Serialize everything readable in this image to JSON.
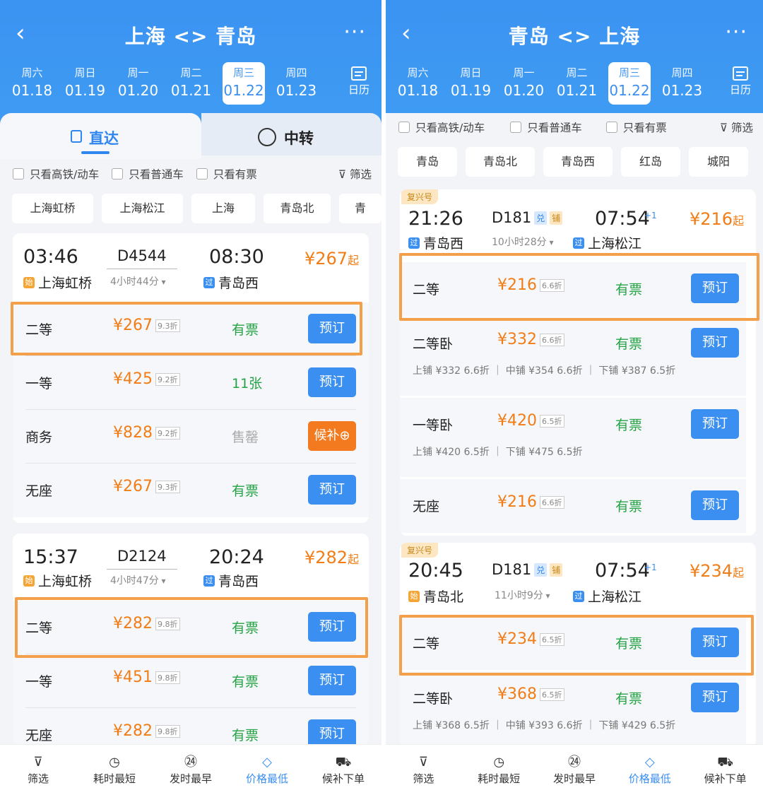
{
  "left": {
    "title": "上海 <> 青岛",
    "dates": [
      {
        "w": "周六",
        "n": "01.18"
      },
      {
        "w": "周日",
        "n": "01.19"
      },
      {
        "w": "周一",
        "n": "01.20"
      },
      {
        "w": "周二",
        "n": "01.21"
      },
      {
        "w": "周三",
        "n": "01.22"
      },
      {
        "w": "周四",
        "n": "01.23"
      }
    ],
    "calendar_label": "日历",
    "tab_direct": "直达",
    "tab_transfer": "中转",
    "filters": [
      "只看高铁/动车",
      "只看普通车",
      "只看有票"
    ],
    "filter_btn": "筛选",
    "stations": [
      "上海虹桥",
      "上海松江",
      "上海",
      "青岛北",
      "青"
    ],
    "trains": [
      {
        "dep": "03:46",
        "arr": "08:30",
        "no": "D4544",
        "dur": "4小时44分",
        "from": "上海虹桥",
        "from_tag": "始",
        "to": "青岛西",
        "to_tag": "过",
        "price": "¥267",
        "price_suffix": "起",
        "seats": [
          {
            "cls": "二等",
            "price": "¥267",
            "disc": "9.3折",
            "av": "有票",
            "btn": "预订"
          },
          {
            "cls": "一等",
            "price": "¥425",
            "disc": "9.2折",
            "av": "11张",
            "btn": "预订"
          },
          {
            "cls": "商务",
            "price": "¥828",
            "disc": "9.2折",
            "av": "售罄",
            "btn": "候补⊕"
          },
          {
            "cls": "无座",
            "price": "¥267",
            "disc": "9.3折",
            "av": "有票",
            "btn": "预订"
          }
        ]
      },
      {
        "dep": "15:37",
        "arr": "20:24",
        "no": "D2124",
        "dur": "4小时47分",
        "from": "上海虹桥",
        "from_tag": "始",
        "to": "青岛西",
        "to_tag": "过",
        "price": "¥282",
        "price_suffix": "起",
        "seats": [
          {
            "cls": "二等",
            "price": "¥282",
            "disc": "9.8折",
            "av": "有票",
            "btn": "预订"
          },
          {
            "cls": "一等",
            "price": "¥451",
            "disc": "9.8折",
            "av": "有票",
            "btn": "预订"
          },
          {
            "cls": "无座",
            "price": "¥282",
            "disc": "9.8折",
            "av": "有票",
            "btn": "预订"
          }
        ]
      }
    ]
  },
  "right": {
    "title": "青岛 <> 上海",
    "dates": [
      {
        "w": "周六",
        "n": "01.18"
      },
      {
        "w": "周日",
        "n": "01.19"
      },
      {
        "w": "周一",
        "n": "01.20"
      },
      {
        "w": "周二",
        "n": "01.21"
      },
      {
        "w": "周三",
        "n": "01.22"
      },
      {
        "w": "周四",
        "n": "01.23"
      }
    ],
    "calendar_label": "日历",
    "filters": [
      "只看高铁/动车",
      "只看普通车",
      "只看有票"
    ],
    "filter_btn": "筛选",
    "stations": [
      "青岛",
      "青岛北",
      "青岛西",
      "红岛",
      "城阳"
    ],
    "trains": [
      {
        "badge": "复兴号",
        "dep": "21:26",
        "arr": "07:54",
        "plus": "+1",
        "no": "D181",
        "tag1": "兑",
        "tag2": "铺",
        "dur": "10小时28分",
        "from": "青岛西",
        "from_tag": "过",
        "to": "上海松江",
        "to_tag": "过",
        "price": "¥216",
        "price_suffix": "起",
        "seats": [
          {
            "cls": "二等",
            "price": "¥216",
            "disc": "6.6折",
            "av": "有票",
            "btn": "预订"
          },
          {
            "cls": "二等卧",
            "price": "¥332",
            "disc": "6.6折",
            "av": "有票",
            "btn": "预订",
            "berths": "上铺 ¥332 6.6折 ｜ 中铺 ¥354 6.6折 ｜ 下铺 ¥387 6.5折"
          },
          {
            "cls": "一等卧",
            "price": "¥420",
            "disc": "6.5折",
            "av": "有票",
            "btn": "预订",
            "berths": "上铺 ¥420 6.5折 ｜ 下铺 ¥475 6.5折"
          },
          {
            "cls": "无座",
            "price": "¥216",
            "disc": "6.6折",
            "av": "有票",
            "btn": "预订"
          }
        ]
      },
      {
        "badge": "复兴号",
        "dep": "20:45",
        "arr": "07:54",
        "plus": "+1",
        "no": "D181",
        "tag1": "兑",
        "tag2": "铺",
        "dur": "11小时9分",
        "from": "青岛北",
        "from_tag": "始",
        "to": "上海松江",
        "to_tag": "过",
        "price": "¥234",
        "price_suffix": "起",
        "seats": [
          {
            "cls": "二等",
            "price": "¥234",
            "disc": "6.5折",
            "av": "有票",
            "btn": "预订"
          },
          {
            "cls": "二等卧",
            "price": "¥368",
            "disc": "6.5折",
            "av": "有票",
            "btn": "预订",
            "berths": "上铺 ¥368 6.5折 ｜ 中铺 ¥393 6.6折 ｜ 下铺 ¥429 6.5折"
          }
        ]
      }
    ]
  },
  "bottom_bar": [
    {
      "label": "筛选",
      "icon": "funnel-icon"
    },
    {
      "label": "耗时最短",
      "icon": "clock-icon"
    },
    {
      "label": "发时最早",
      "icon": "24h-icon"
    },
    {
      "label": "价格最低",
      "icon": "price-tag-icon",
      "active": true
    },
    {
      "label": "候补下单",
      "icon": "cart-icon"
    }
  ],
  "colors": {
    "primary": "#3a8ff0",
    "price": "#f07d17",
    "available": "#25a344",
    "highlight": "#f4a04b"
  }
}
